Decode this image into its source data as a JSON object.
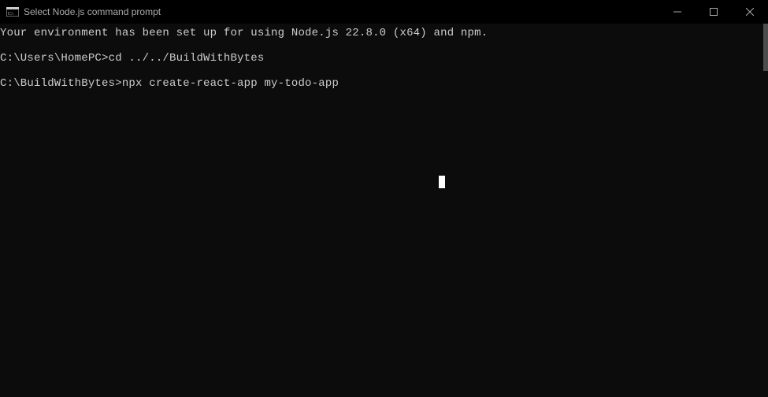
{
  "window": {
    "title": "Select Node.js command prompt"
  },
  "terminal": {
    "lines": [
      "Your environment has been set up for using Node.js 22.8.0 (x64) and npm.",
      "",
      "C:\\Users\\HomePC>cd ../../BuildWithBytes",
      "",
      "C:\\BuildWithBytes>npx create-react-app my-todo-app"
    ]
  }
}
